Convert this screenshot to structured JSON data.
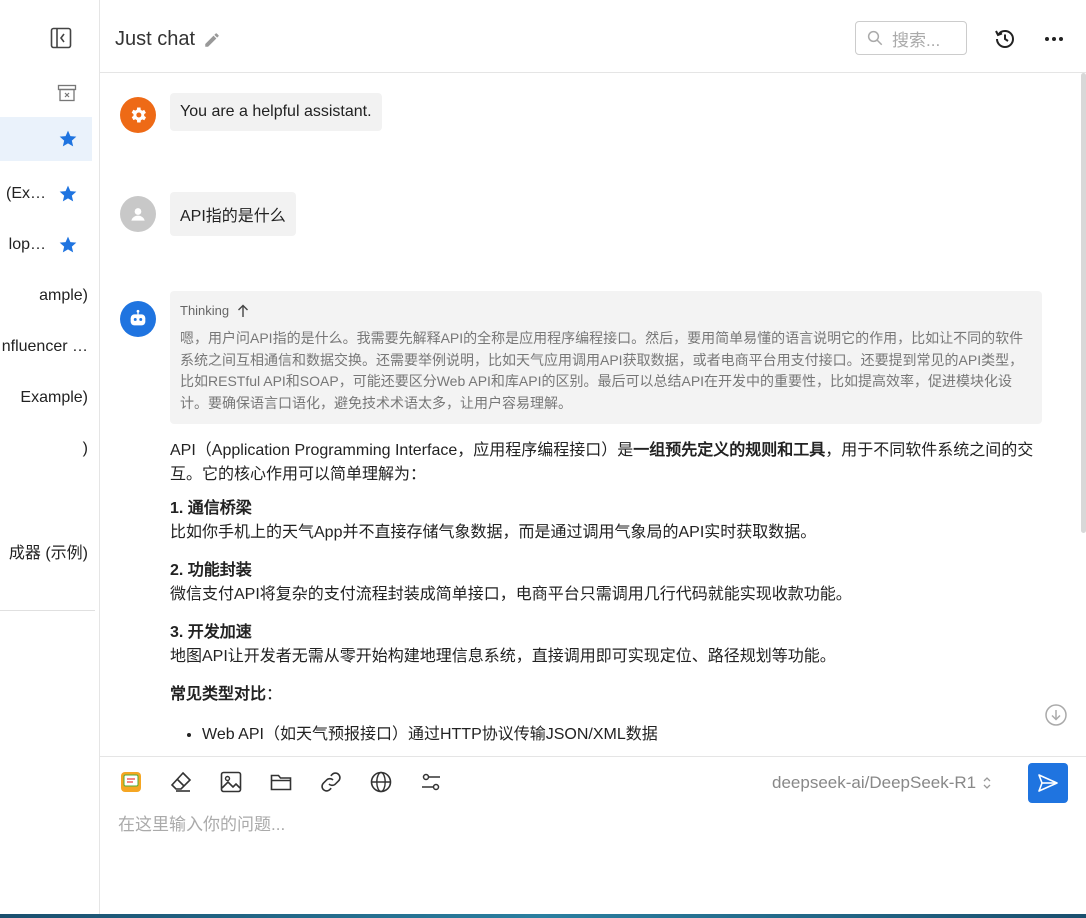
{
  "header": {
    "title": "Just chat",
    "search_placeholder": "搜索..."
  },
  "sidebar": {
    "items": [
      {
        "label": "",
        "starred": true,
        "active": true
      },
      {
        "label": "(Ex…",
        "starred": true
      },
      {
        "label": "lop…",
        "starred": true
      },
      {
        "label": "ample)",
        "starred": false
      },
      {
        "label": "nfluencer …",
        "starred": false
      },
      {
        "label": "Example)",
        "starred": false
      },
      {
        "label": ")",
        "starred": false
      },
      {
        "label": "",
        "starred": false
      },
      {
        "label": "成器 (示例)",
        "starred": false
      }
    ]
  },
  "messages": {
    "system": "You are a helpful assistant.",
    "user": "API指的是什么",
    "thinking_label": "Thinking",
    "thinking_text": "嗯，用户问API指的是什么。我需要先解释API的全称是应用程序编程接口。然后，要用简单易懂的语言说明它的作用，比如让不同的软件系统之间互相通信和数据交换。还需要举例说明，比如天气应用调用API获取数据，或者电商平台用支付接口。还要提到常见的API类型，比如RESTful API和SOAP，可能还要区分Web API和库API的区别。最后可以总结API在开发中的重要性，比如提高效率，促进模块化设计。要确保语言口语化，避免技术术语太多，让用户容易理解。",
    "answer": {
      "intro_pre": "API（Application Programming Interface，应用程序编程接口）是",
      "intro_bold": "一组预先定义的规则和工具",
      "intro_post": "，用于不同软件系统之间的交互。它的核心作用可以简单理解为：",
      "sections": [
        {
          "title": "1. 通信桥梁",
          "body": "比如你手机上的天气App并不直接存储气象数据，而是通过调用气象局的API实时获取数据。"
        },
        {
          "title": "2. 功能封装",
          "body": "微信支付API将复杂的支付流程封装成简单接口，电商平台只需调用几行代码就能实现收款功能。"
        },
        {
          "title": "3. 开发加速",
          "body": "地图API让开发者无需从零开始构建地理信息系统，直接调用即可实现定位、路径规划等功能。"
        }
      ],
      "compare_title": "常见类型对比",
      "compare_colon": "：",
      "list": [
        "Web API（如天气预报接口）通过HTTP协议传输JSON/XML数据"
      ]
    }
  },
  "input": {
    "model": "deepseek-ai/DeepSeek-R1",
    "placeholder": "在这里输入你的问题..."
  },
  "icons": {
    "accent": "#1f74e0",
    "system_avatar": "#ee6a16",
    "user_avatar": "#c8c8c8"
  }
}
